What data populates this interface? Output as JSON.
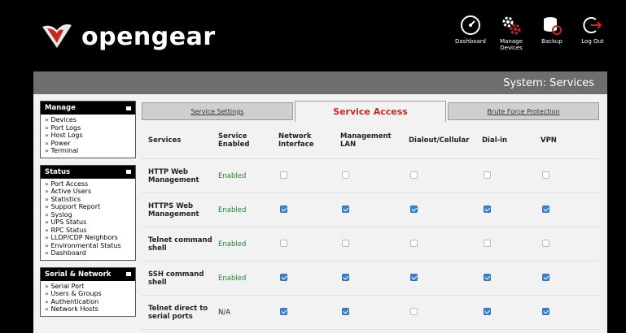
{
  "brand": {
    "name": "opengear"
  },
  "topnav": [
    {
      "label": "Dashboard",
      "icon": "dashboard-icon"
    },
    {
      "label": "Manage Devices",
      "icon": "gears-icon"
    },
    {
      "label": "Backup",
      "icon": "backup-icon"
    },
    {
      "label": "Log Out",
      "icon": "logout-icon"
    }
  ],
  "page": {
    "title": "System: Services"
  },
  "sidebar": {
    "sections": [
      {
        "title": "Manage",
        "items": [
          "Devices",
          "Port Logs",
          "Host Logs",
          "Power",
          "Terminal"
        ]
      },
      {
        "title": "Status",
        "items": [
          "Port Access",
          "Active Users",
          "Statistics",
          "Support Report",
          "Syslog",
          "UPS Status",
          "RPC Status",
          "LLDP/CDP Neighbors",
          "Environmental Status",
          "Dashboard"
        ]
      },
      {
        "title": "Serial & Network",
        "items": [
          "Serial Port",
          "Users & Groups",
          "Authentication",
          "Network Hosts"
        ]
      }
    ]
  },
  "tabs": [
    {
      "label": "Service Settings",
      "active": false
    },
    {
      "label": "Service Access",
      "active": true
    },
    {
      "label": "Brute Force Protection",
      "active": false
    }
  ],
  "table": {
    "headers": [
      "Services",
      "Service Enabled",
      "Network Interface",
      "Management LAN",
      "Dialout/Cellular",
      "Dial-in",
      "VPN"
    ],
    "rows": [
      {
        "service": "HTTP Web Management",
        "enabled": "Enabled",
        "checks": [
          false,
          false,
          false,
          false,
          false
        ]
      },
      {
        "service": "HTTPS Web Management",
        "enabled": "Enabled",
        "checks": [
          true,
          true,
          true,
          true,
          true
        ]
      },
      {
        "service": "Telnet command shell",
        "enabled": "Enabled",
        "checks": [
          false,
          false,
          false,
          false,
          false
        ]
      },
      {
        "service": "SSH command shell",
        "enabled": "Enabled",
        "checks": [
          true,
          true,
          true,
          true,
          true
        ]
      },
      {
        "service": "Telnet direct to serial ports",
        "enabled": "N/A",
        "checks": [
          true,
          true,
          false,
          true,
          true
        ]
      }
    ]
  },
  "colors": {
    "accent": "#c8281e",
    "enabled": "#2e7d32",
    "checkbox_on": "#3b82d6"
  }
}
